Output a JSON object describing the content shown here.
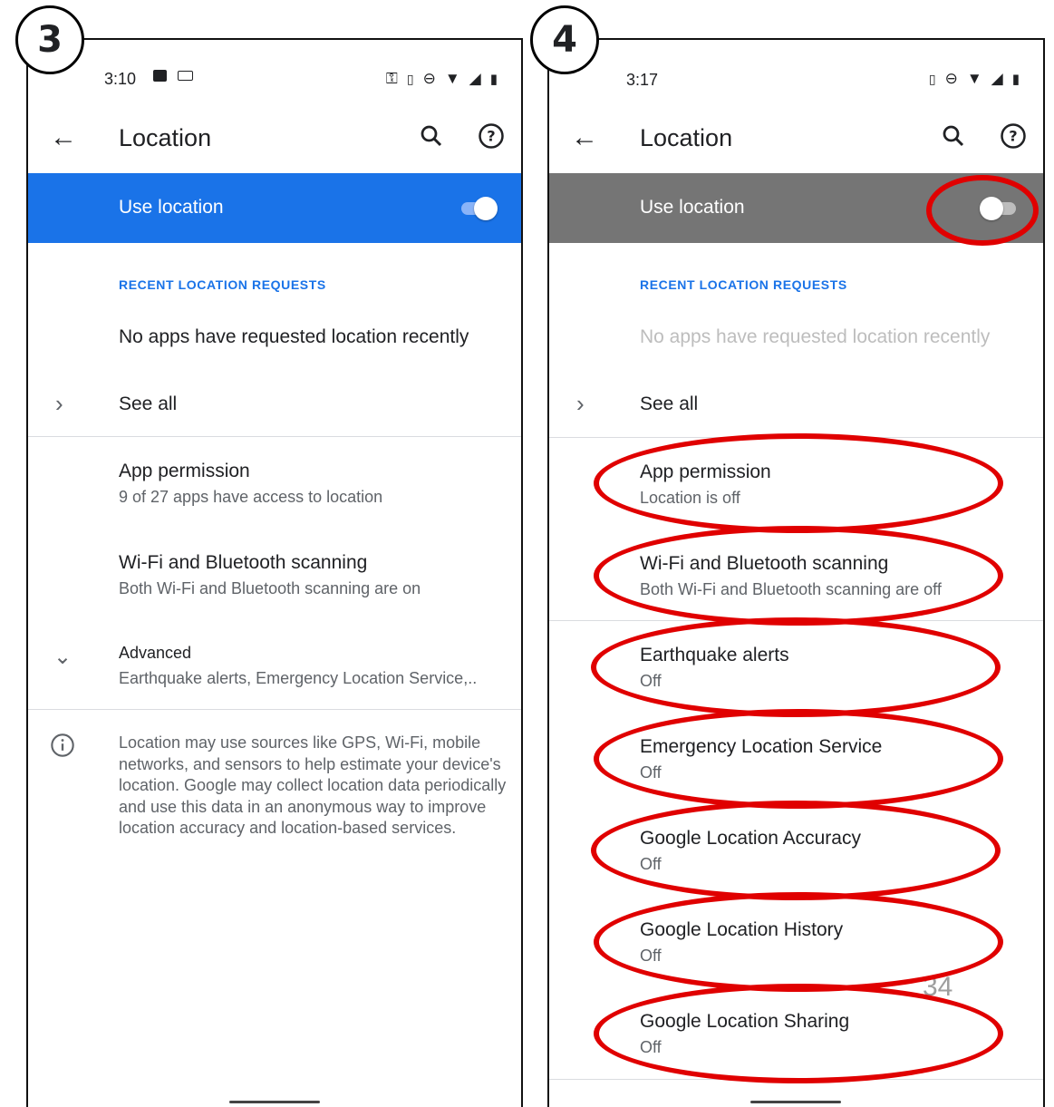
{
  "badges": {
    "step3": "3",
    "step4": "4"
  },
  "screen3": {
    "status_time": "3:10",
    "status_icons_left": [
      "image-icon",
      "keyboard-icon"
    ],
    "status_icons_right": [
      "vpn-key-icon",
      "vibrate-icon",
      "dnd-icon",
      "wifi-icon",
      "signal-icon",
      "battery-icon"
    ],
    "title": "Location",
    "use_location_label": "Use location",
    "use_location_on": true,
    "accent_color": "#1a73e8",
    "recent_header": "RECENT LOCATION REQUESTS",
    "no_apps_text": "No apps have requested location recently",
    "see_all": "See all",
    "items": [
      {
        "title": "App permission",
        "subtitle": "9 of 27 apps have access to location"
      },
      {
        "title": "Wi-Fi and Bluetooth scanning",
        "subtitle": "Both Wi-Fi and Bluetooth scanning are on"
      },
      {
        "title": "Advanced",
        "subtitle": "Earthquake alerts, Emergency Location Service,.."
      }
    ],
    "info_text": "Location may use sources like GPS, Wi-Fi, mobile networks, and sensors to help estimate your device's location. Google may collect location data periodically and use this data in an anonymous way to improve location accuracy and location-based services."
  },
  "screen4": {
    "status_time": "3:17",
    "status_icons_right": [
      "vibrate-icon",
      "dnd-icon",
      "wifi-icon",
      "signal-icon",
      "battery-icon"
    ],
    "title": "Location",
    "use_location_label": "Use location",
    "use_location_on": false,
    "bar_color": "#757575",
    "recent_header": "RECENT LOCATION REQUESTS",
    "no_apps_text": "No apps have requested location recently",
    "see_all": "See all",
    "items": [
      {
        "title": "App permission",
        "subtitle": "Location is off"
      },
      {
        "title": "Wi-Fi and Bluetooth scanning",
        "subtitle": "Both Wi-Fi and Bluetooth scanning are off"
      },
      {
        "title": "Earthquake alerts",
        "subtitle": "Off"
      },
      {
        "title": "Emergency Location Service",
        "subtitle": "Off"
      },
      {
        "title": "Google Location Accuracy",
        "subtitle": "Off"
      },
      {
        "title": "Google Location History",
        "subtitle": "Off"
      },
      {
        "title": "Google Location Sharing",
        "subtitle": "Off"
      }
    ]
  },
  "annotation_color": "#e00000",
  "page_number": "34"
}
